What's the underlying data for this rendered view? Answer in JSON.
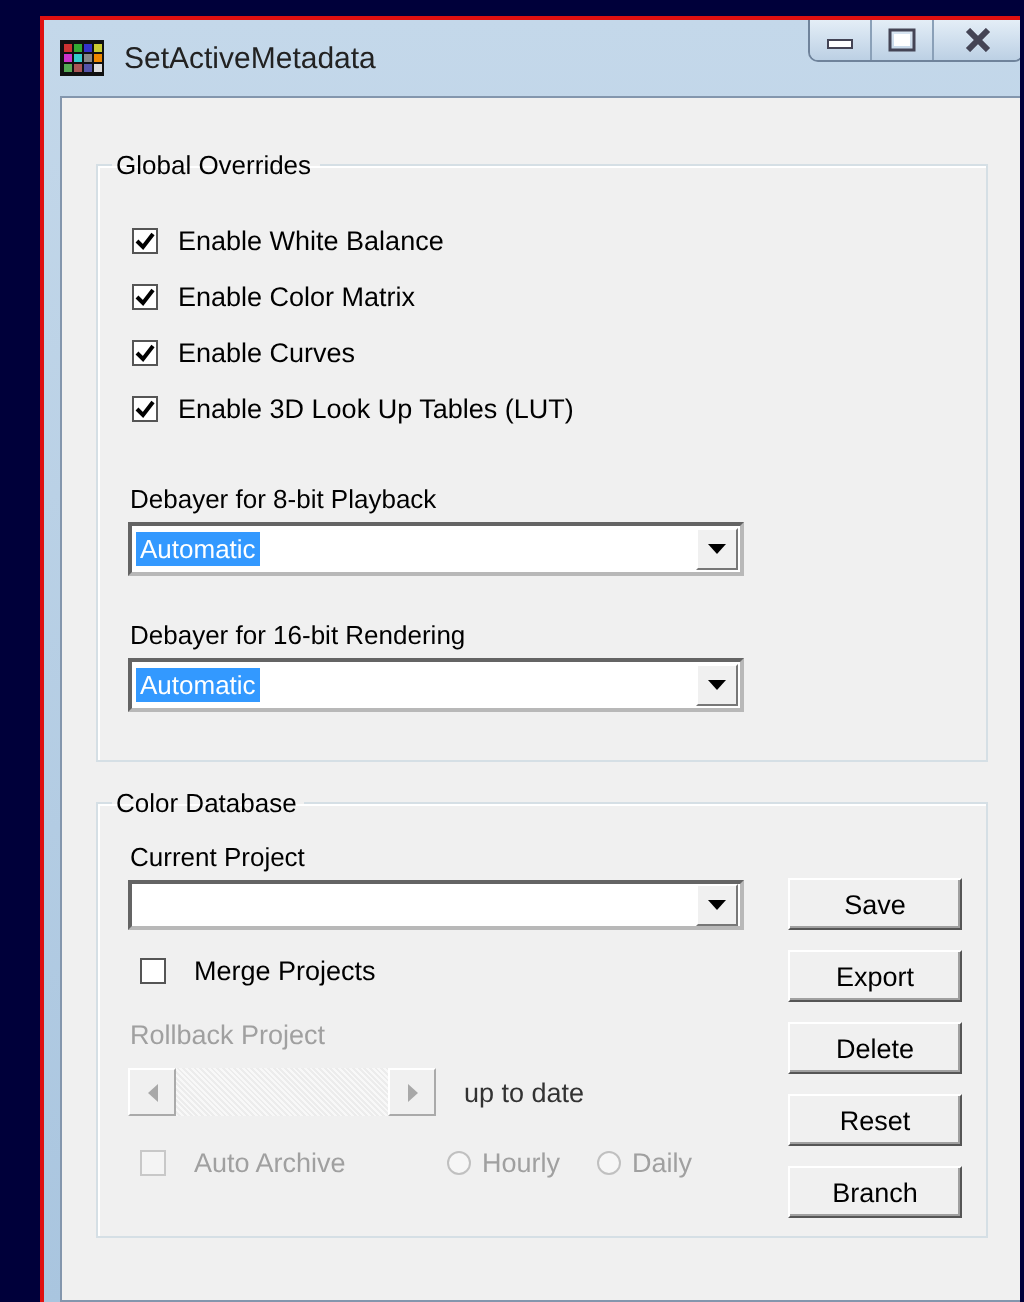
{
  "window": {
    "title": "SetActiveMetadata"
  },
  "global_overrides": {
    "title": "Global Overrides",
    "options": [
      {
        "label": "Enable White Balance",
        "checked": true
      },
      {
        "label": "Enable Color Matrix",
        "checked": true
      },
      {
        "label": "Enable Curves",
        "checked": true
      },
      {
        "label": "Enable 3D Look Up Tables (LUT)",
        "checked": true
      }
    ],
    "dropdowns": [
      {
        "label": "Debayer for 8-bit Playback",
        "value": "Automatic",
        "highlighted": true
      },
      {
        "label": "Debayer for 16-bit Rendering",
        "value": "Automatic",
        "highlighted": true
      }
    ]
  },
  "color_database": {
    "title": "Color Database",
    "current_project": {
      "label": "Current Project"
    },
    "merge_projects": {
      "label": "Merge Projects",
      "checked": false,
      "disabled": false
    },
    "rollback": {
      "label": "Rollback Project",
      "disabled": true,
      "reading": "up to date"
    },
    "auto_archive": {
      "label": "Auto Archive",
      "checked": false,
      "disabled": true
    },
    "schedule": [
      {
        "label": "Hourly",
        "selected": false,
        "disabled": true
      },
      {
        "label": "Daily",
        "selected": false,
        "disabled": true
      }
    ],
    "buttons": [
      "Save",
      "Export",
      "Delete",
      "Reset",
      "Branch"
    ]
  }
}
